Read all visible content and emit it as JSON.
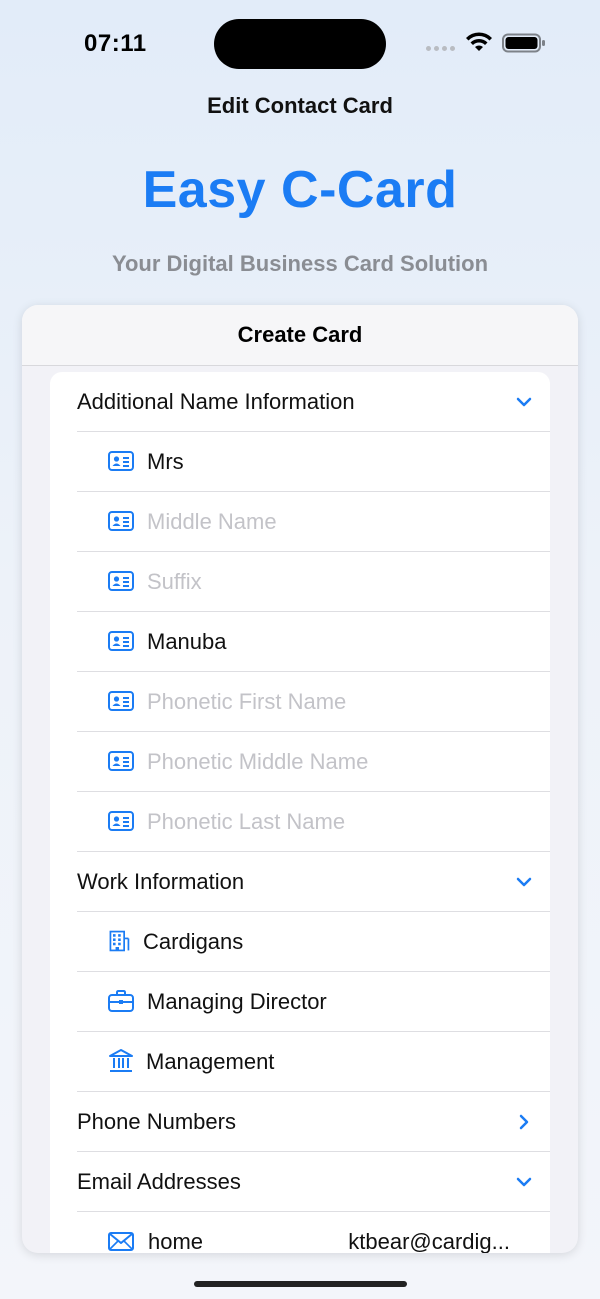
{
  "status_bar": {
    "time": "07:11"
  },
  "nav": {
    "title": "Edit Contact Card"
  },
  "hero": {
    "brand": "Easy C-Card",
    "tagline": "Your Digital Business Card Solution"
  },
  "sheet": {
    "title": "Create Card"
  },
  "sections": {
    "additional_name": {
      "title": "Additional Name Information",
      "fields": {
        "prefix": {
          "value": "Mrs"
        },
        "middle_name": {
          "placeholder": "Middle Name"
        },
        "suffix": {
          "placeholder": "Suffix"
        },
        "nickname": {
          "value": "Manuba"
        },
        "phonetic_first": {
          "placeholder": "Phonetic First Name"
        },
        "phonetic_middle": {
          "placeholder": "Phonetic Middle Name"
        },
        "phonetic_last": {
          "placeholder": "Phonetic Last Name"
        }
      }
    },
    "work": {
      "title": "Work Information",
      "company": "Cardigans",
      "job_title": "Managing Director",
      "department": "Management"
    },
    "phone": {
      "title": "Phone Numbers"
    },
    "email": {
      "title": "Email Addresses",
      "items": [
        {
          "label": "home",
          "value": "ktbear@cardig..."
        }
      ]
    }
  },
  "colors": {
    "accent": "#1b7cf4",
    "placeholder": "#c3c3c8",
    "tagline": "#8a8d93"
  }
}
